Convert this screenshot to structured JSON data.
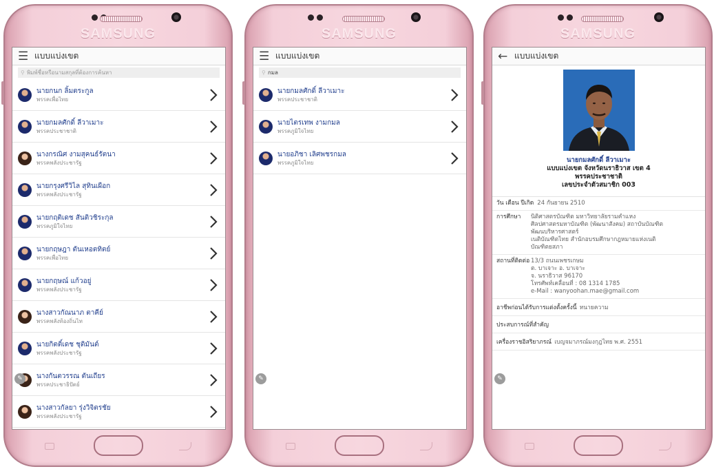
{
  "brand": "SAMSUNG",
  "screen1": {
    "title": "แบบแบ่งเขต",
    "search_placeholder": "พิมพ์ชื่อหรือนามสกุลที่ต้องการค้นหา",
    "items": [
      {
        "name": "นายกนก ลิ้มตระกูล",
        "party": "พรรคเพื่อไทย"
      },
      {
        "name": "นายกมลศักดิ์ ลีวาเมาะ",
        "party": "พรรคประชาชาติ"
      },
      {
        "name": "นางกรณิศ งามสุคนธ์รัตนา",
        "party": "พรรคพลังประชารัฐ"
      },
      {
        "name": "นายกรุงศรีวิไล สุทินเผือก",
        "party": "พรรคพลังประชารัฐ"
      },
      {
        "name": "นายกฤติเดช สันติวชิระกุล",
        "party": "พรรคภูมิใจไทย"
      },
      {
        "name": "นายกฤษฎา ตันเหอตทิตย์",
        "party": "พรรคเพื่อไทย"
      },
      {
        "name": "นายกฤษณ์ แก้วอยู่",
        "party": "พรรคพลังประชารัฐ"
      },
      {
        "name": "นางสาวกัณนาภ ตาคีย์",
        "party": "พรรคพลังท้องถิ่นไท"
      },
      {
        "name": "นายกิตติ์เดช ชุติมันต์",
        "party": "พรรคพลังประชารัฐ"
      },
      {
        "name": "นางกันตวรรณ ตันเถียร",
        "party": "พรรคประชาธิปัตย์"
      },
      {
        "name": "นางสาวกัลยา รุ่งวิจิตรชัย",
        "party": "พรรคพลังประชารัฐ"
      }
    ]
  },
  "screen2": {
    "title": "แบบแบ่งเขต",
    "search_value": "กมล",
    "items": [
      {
        "name": "นายกมลศักดิ์ ลีวาเมาะ",
        "party": "พรรคประชาชาติ"
      },
      {
        "name": "นายไตรเทพ งามกมล",
        "party": "พรรคภูมิใจไทย"
      },
      {
        "name": "นายอภิชา เลิศพชรกมล",
        "party": "พรรคภูมิใจไทย"
      }
    ]
  },
  "screen3": {
    "title": "แบบแบ่งเขต",
    "name": "นายกมลศักดิ์ ลีวาเมาะ",
    "district": "แบบแบ่งเขต จังหวัดนราธิวาส เขต 4",
    "party": "พรรคประชาชาติ",
    "member_id": "เลขประจำตัวสมาชิก 003",
    "birth_label": "วัน เดือน ปีเกิด",
    "birth_value": "24 กันยายน 2510",
    "edu_label": "การศึกษา",
    "edu_lines": [
      "นิติศาสตรบัณฑิต มหาวิทยาลัยรามคำแหง",
      "ศิลปศาสตรมหาบัณฑิต (พัฒนาสังคม) สถาบันบัณฑิต",
      "พัฒนบริหารศาสตร์",
      "เนติบัณฑิตไทย สำนักอบรมศึกษากฎหมายแห่งเนติ",
      "บัณฑิตยสภา"
    ],
    "addr_label": "สถานที่ติดต่อ",
    "addr_lines": [
      "13/3 ถนนเพชรเกษม",
      "ต. บาเจาะ อ. บาเจาะ",
      "จ. นราธิวาส 96170",
      "โทรศัพท์เคลื่อนที่ : 08 1314 1785",
      "e-Mail : wanyoohan.mae@gmail.com"
    ],
    "career_label": "อาชีพก่อนได้รับการแต่งตั้งครั้งนี้",
    "career_value": "หนายความ",
    "exp_label": "ประสบการณ์ที่สำคัญ",
    "decor_label": "เครื่องราชอิสริยาภรณ์",
    "decor_value": "เบญจมาภรณ์มงกุฎไทย พ.ศ. 2551"
  },
  "colors": {
    "phone": "#f4cfd9",
    "name": "#1f3d8c",
    "photo_bg": "#2a6cb8"
  },
  "icons": {
    "menu": "hamburger-icon",
    "back": "back-arrow-icon",
    "search": "search-icon",
    "chevron": "chevron-right-icon"
  }
}
